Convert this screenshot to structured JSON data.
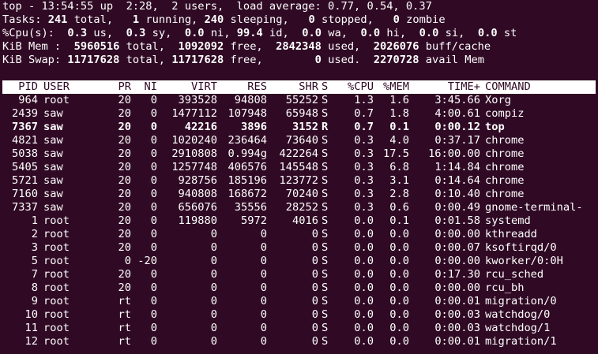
{
  "summary": {
    "line1": {
      "prefix": "top - 13:54:55 up  2:28,  2 users,  load average: 0.77, 0.54, 0.37"
    },
    "tasks": {
      "label": "Tasks:",
      "total": "241",
      "total_lbl": "total,",
      "running": "1",
      "running_lbl": "running,",
      "sleeping": "240",
      "sleeping_lbl": "sleeping,",
      "stopped": "0",
      "stopped_lbl": "stopped,",
      "zombie": "0",
      "zombie_lbl": "zombie"
    },
    "cpu": {
      "label": "%Cpu(s):",
      "us": "0.3",
      "us_lbl": "us,",
      "sy": "0.3",
      "sy_lbl": "sy,",
      "ni": "0.0",
      "ni_lbl": "ni,",
      "id": "99.4",
      "id_lbl": "id,",
      "wa": "0.0",
      "wa_lbl": "wa,",
      "hi": "0.0",
      "hi_lbl": "hi,",
      "si": "0.0",
      "si_lbl": "si,",
      "st": "0.0",
      "st_lbl": "st"
    },
    "mem": {
      "label": "KiB Mem :",
      "total": "5960516",
      "total_lbl": "total,",
      "free": "1092092",
      "free_lbl": "free,",
      "used": "2842348",
      "used_lbl": "used,",
      "buff": "2026076",
      "buff_lbl": "buff/cache"
    },
    "swap": {
      "label": "KiB Swap:",
      "total": "11717628",
      "total_lbl": "total,",
      "free": "11717628",
      "free_lbl": "free,",
      "used": "0",
      "used_lbl": "used.",
      "avail": "2270728",
      "avail_lbl": "avail Mem"
    }
  },
  "table": {
    "headers": {
      "pid": "PID",
      "user": "USER",
      "pr": "PR",
      "ni": "NI",
      "virt": "VIRT",
      "res": "RES",
      "shr": "SHR",
      "s": "S",
      "cpu": "%CPU",
      "mem": "%MEM",
      "time": "TIME+",
      "cmd": "COMMAND"
    },
    "rows": [
      {
        "pid": "964",
        "user": "root",
        "pr": "20",
        "ni": "0",
        "virt": "393528",
        "res": "94808",
        "shr": "55252",
        "s": "S",
        "cpu": "1.3",
        "mem": "1.6",
        "time": "3:45.66",
        "cmd": "Xorg"
      },
      {
        "pid": "2439",
        "user": "saw",
        "pr": "20",
        "ni": "0",
        "virt": "1477112",
        "res": "107948",
        "shr": "65948",
        "s": "S",
        "cpu": "0.7",
        "mem": "1.8",
        "time": "4:00.61",
        "cmd": "compiz"
      },
      {
        "pid": "7367",
        "user": "saw",
        "pr": "20",
        "ni": "0",
        "virt": "42216",
        "res": "3896",
        "shr": "3152",
        "s": "R",
        "cpu": "0.7",
        "mem": "0.1",
        "time": "0:00.12",
        "cmd": "top"
      },
      {
        "pid": "4821",
        "user": "saw",
        "pr": "20",
        "ni": "0",
        "virt": "1020240",
        "res": "236464",
        "shr": "73640",
        "s": "S",
        "cpu": "0.3",
        "mem": "4.0",
        "time": "0:37.17",
        "cmd": "chrome"
      },
      {
        "pid": "5038",
        "user": "saw",
        "pr": "20",
        "ni": "0",
        "virt": "2910808",
        "res": "0.994g",
        "shr": "422264",
        "s": "S",
        "cpu": "0.3",
        "mem": "17.5",
        "time": "16:00.00",
        "cmd": "chrome"
      },
      {
        "pid": "5405",
        "user": "saw",
        "pr": "20",
        "ni": "0",
        "virt": "1257748",
        "res": "406576",
        "shr": "145548",
        "s": "S",
        "cpu": "0.3",
        "mem": "6.8",
        "time": "1:14.84",
        "cmd": "chrome"
      },
      {
        "pid": "5721",
        "user": "saw",
        "pr": "20",
        "ni": "0",
        "virt": "928756",
        "res": "185196",
        "shr": "123772",
        "s": "S",
        "cpu": "0.3",
        "mem": "3.1",
        "time": "0:14.64",
        "cmd": "chrome"
      },
      {
        "pid": "7160",
        "user": "saw",
        "pr": "20",
        "ni": "0",
        "virt": "940808",
        "res": "168672",
        "shr": "70240",
        "s": "S",
        "cpu": "0.3",
        "mem": "2.8",
        "time": "0:10.40",
        "cmd": "chrome"
      },
      {
        "pid": "7337",
        "user": "saw",
        "pr": "20",
        "ni": "0",
        "virt": "656076",
        "res": "35556",
        "shr": "28252",
        "s": "S",
        "cpu": "0.3",
        "mem": "0.6",
        "time": "0:00.49",
        "cmd": "gnome-terminal-"
      },
      {
        "pid": "1",
        "user": "root",
        "pr": "20",
        "ni": "0",
        "virt": "119880",
        "res": "5972",
        "shr": "4016",
        "s": "S",
        "cpu": "0.0",
        "mem": "0.1",
        "time": "0:01.58",
        "cmd": "systemd"
      },
      {
        "pid": "2",
        "user": "root",
        "pr": "20",
        "ni": "0",
        "virt": "0",
        "res": "0",
        "shr": "0",
        "s": "S",
        "cpu": "0.0",
        "mem": "0.0",
        "time": "0:00.00",
        "cmd": "kthreadd"
      },
      {
        "pid": "3",
        "user": "root",
        "pr": "20",
        "ni": "0",
        "virt": "0",
        "res": "0",
        "shr": "0",
        "s": "S",
        "cpu": "0.0",
        "mem": "0.0",
        "time": "0:00.07",
        "cmd": "ksoftirqd/0"
      },
      {
        "pid": "5",
        "user": "root",
        "pr": "0",
        "ni": "-20",
        "virt": "0",
        "res": "0",
        "shr": "0",
        "s": "S",
        "cpu": "0.0",
        "mem": "0.0",
        "time": "0:00.00",
        "cmd": "kworker/0:0H"
      },
      {
        "pid": "7",
        "user": "root",
        "pr": "20",
        "ni": "0",
        "virt": "0",
        "res": "0",
        "shr": "0",
        "s": "S",
        "cpu": "0.0",
        "mem": "0.0",
        "time": "0:17.30",
        "cmd": "rcu_sched"
      },
      {
        "pid": "8",
        "user": "root",
        "pr": "20",
        "ni": "0",
        "virt": "0",
        "res": "0",
        "shr": "0",
        "s": "S",
        "cpu": "0.0",
        "mem": "0.0",
        "time": "0:00.00",
        "cmd": "rcu_bh"
      },
      {
        "pid": "9",
        "user": "root",
        "pr": "rt",
        "ni": "0",
        "virt": "0",
        "res": "0",
        "shr": "0",
        "s": "S",
        "cpu": "0.0",
        "mem": "0.0",
        "time": "0:00.01",
        "cmd": "migration/0"
      },
      {
        "pid": "10",
        "user": "root",
        "pr": "rt",
        "ni": "0",
        "virt": "0",
        "res": "0",
        "shr": "0",
        "s": "S",
        "cpu": "0.0",
        "mem": "0.0",
        "time": "0:00.03",
        "cmd": "watchdog/0"
      },
      {
        "pid": "11",
        "user": "root",
        "pr": "rt",
        "ni": "0",
        "virt": "0",
        "res": "0",
        "shr": "0",
        "s": "S",
        "cpu": "0.0",
        "mem": "0.0",
        "time": "0:00.03",
        "cmd": "watchdog/1"
      },
      {
        "pid": "12",
        "user": "root",
        "pr": "rt",
        "ni": "0",
        "virt": "0",
        "res": "0",
        "shr": "0",
        "s": "S",
        "cpu": "0.0",
        "mem": "0.0",
        "time": "0:00.01",
        "cmd": "migration/1"
      }
    ],
    "highlight_pid": "7367"
  },
  "colors": {
    "background": "#300a24",
    "foreground": "#ffffff"
  }
}
